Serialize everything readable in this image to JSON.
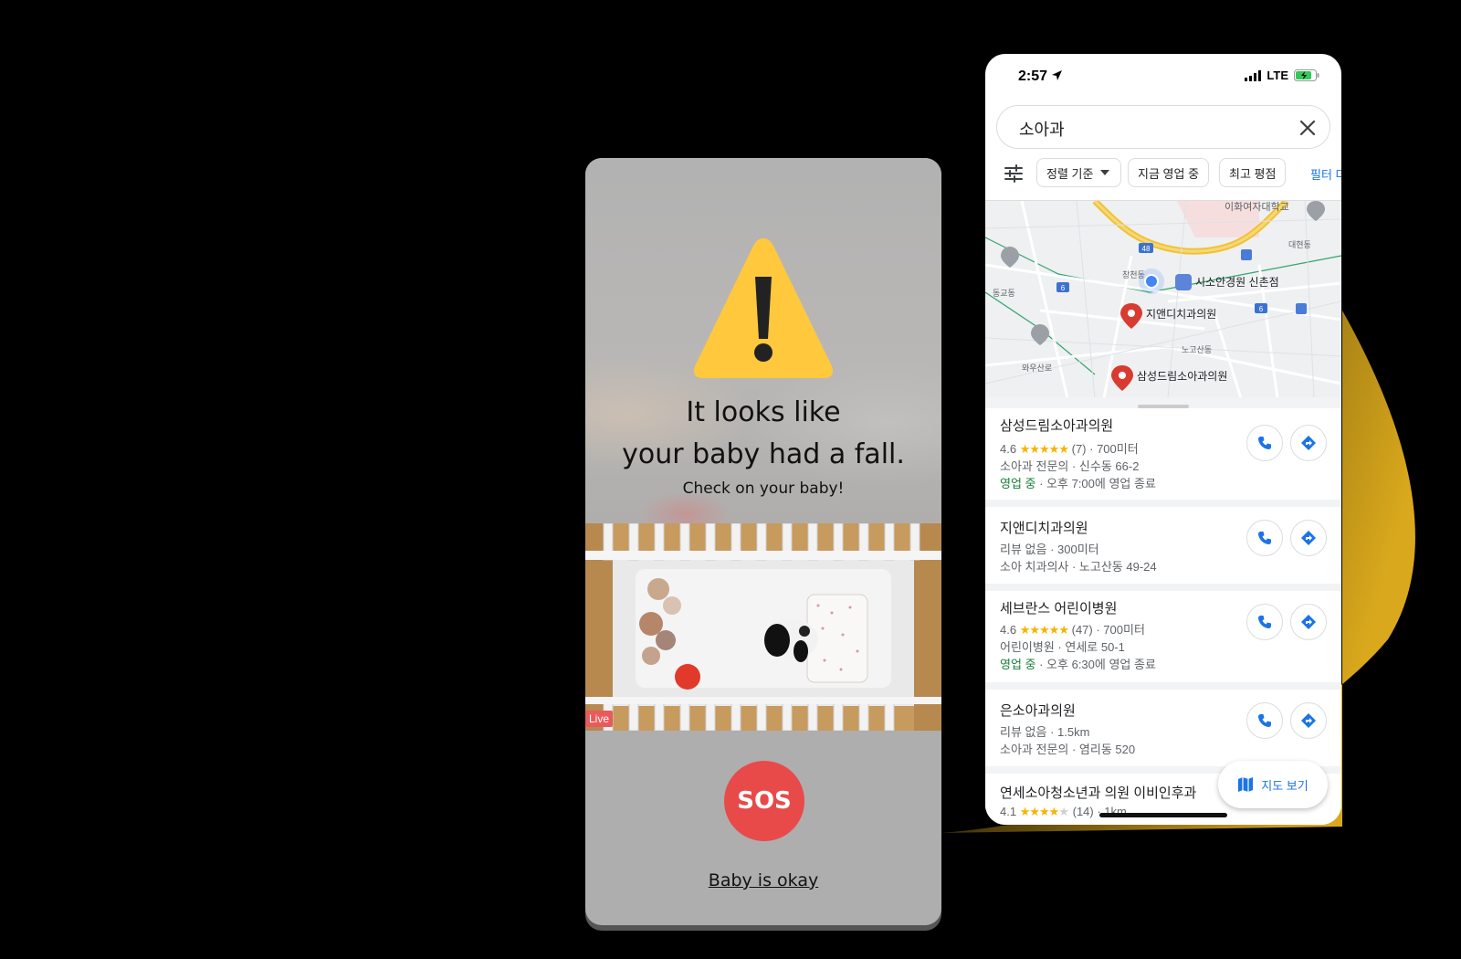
{
  "alert": {
    "title_line1": "It looks like",
    "title_line2": "your baby had a fall.",
    "subtitle": "Check on your baby!",
    "live_label": "Live",
    "sos_label": "SOS",
    "okay_link": "Baby is okay",
    "colors": {
      "warning": "#FFC83D",
      "sos": "#E84A4A",
      "background": "#AEAEAE"
    }
  },
  "maps": {
    "status": {
      "time": "2:57",
      "network": "LTE"
    },
    "search": {
      "query": "소아과"
    },
    "filters": {
      "sort_label": "정렬 기준",
      "open_now_label": "지금 영업 중",
      "top_rated_label": "최고 평점",
      "more_label": "필터 더"
    },
    "map_labels": {
      "university": "이화여자대학교",
      "daehyeon": "대현동",
      "changcheon": "창천동",
      "donggyo": "동교동",
      "nogosan": "노고산동",
      "wawoosan": "와우산로",
      "road48": "48",
      "road6a": "6",
      "road6b": "6",
      "park": "시소안경원 신촌점",
      "pin_dental": "지앤디치과의원",
      "pin_samsung": "삼성드림소아과의원"
    },
    "results": [
      {
        "name": "삼성드림소아과의원",
        "rating": "4.6",
        "stars": "★★★★★",
        "reviews": "(7)",
        "distance": "700미터",
        "category": "소아과 전문의 · 신수동 66-2",
        "open": "영업 중",
        "hours": " · 오후 7:00에 영업 종료"
      },
      {
        "name": "지앤디치과의원",
        "reviews_none": "리뷰 없음 · 300미터",
        "category": "소아 치과의사 · 노고산동 49-24"
      },
      {
        "name": "세브란스 어린이병원",
        "rating": "4.6",
        "stars": "★★★★★",
        "reviews": "(47)",
        "distance": "700미터",
        "category": "어린이병원 · 연세로 50-1",
        "open": "영업 중",
        "hours": " · 오후 6:30에 영업 종료"
      },
      {
        "name": "은소아과의원",
        "reviews_none": "리뷰 없음 · 1.5km",
        "category": "소아과 전문의 · 염리동 520"
      },
      {
        "name": "연세소아청소년과 의원 이비인후과",
        "rating": "4.1",
        "stars": "★★★★",
        "stars_empty": "★",
        "reviews": "(14)",
        "distance": "1km"
      }
    ],
    "map_view_label": "지도 보기",
    "colors": {
      "accent": "#1A73E8",
      "open": "#188038",
      "star": "#F4B400"
    }
  }
}
